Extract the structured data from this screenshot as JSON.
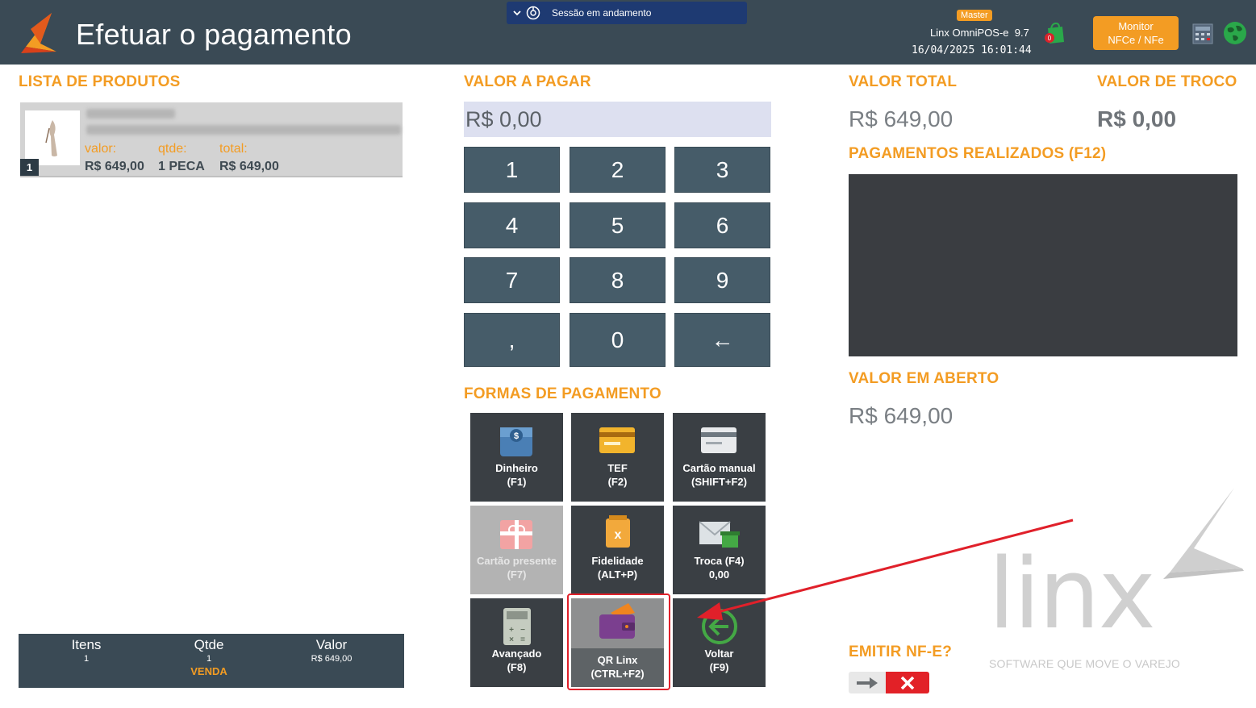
{
  "header": {
    "title": "Efetuar o pagamento",
    "session_text": "Sessão em andamento",
    "badge": "Master",
    "app_name": "Linx OmniPOS-e",
    "app_version": "9.7",
    "datetime": "16/04/2025 16:01:44",
    "bag_count": "0",
    "monitor_line1": "Monitor",
    "monitor_line2": "NFCe / NFe"
  },
  "products": {
    "title": "LISTA DE PRODUTOS",
    "items": [
      {
        "index": "1",
        "valor_label": "valor:",
        "qtde_label": "qtde:",
        "total_label": "total:",
        "valor": "R$ 649,00",
        "qtde": "1 PECA",
        "total": "R$ 649,00"
      }
    ]
  },
  "summary": {
    "itens_label": "Itens",
    "itens_value": "1",
    "qtde_label": "Qtde",
    "qtde_value": "1",
    "qtde_type": "VENDA",
    "valor_label": "Valor",
    "valor_value": "R$ 649,00"
  },
  "payment": {
    "title": "VALOR A PAGAR",
    "amount": "R$ 0,00"
  },
  "keypad": [
    "1",
    "2",
    "3",
    "4",
    "5",
    "6",
    "7",
    "8",
    "9",
    ",",
    "0",
    "←"
  ],
  "methods": {
    "title": "FORMAS DE PAGAMENTO",
    "items": [
      {
        "line1": "Dinheiro",
        "line2": "(F1)",
        "icon": "cash-icon"
      },
      {
        "line1": "TEF",
        "line2": "(F2)",
        "icon": "tef-card-icon"
      },
      {
        "line1": "Cartão manual",
        "line2": "(SHIFT+F2)",
        "icon": "manual-card-icon"
      },
      {
        "line1": "Cartão presente",
        "line2": "(F7)",
        "icon": "gift-card-icon"
      },
      {
        "line1": "Fidelidade",
        "line2": "(ALT+P)",
        "icon": "loyalty-icon"
      },
      {
        "line1": "Troca (F4)",
        "line2": "0,00",
        "icon": "exchange-icon"
      },
      {
        "line1": "Avançado",
        "line2": "(F8)",
        "icon": "calculator-icon"
      },
      {
        "line1": "QR Linx",
        "line2": "(CTRL+F2)",
        "icon": "wallet-icon"
      },
      {
        "line1": "Voltar",
        "line2": "(F9)",
        "icon": "back-arrow-icon"
      }
    ]
  },
  "totals": {
    "total_title": "VALOR TOTAL",
    "total_value": "R$ 649,00",
    "change_title": "VALOR DE TROCO",
    "change_value": "R$ 0,00",
    "payments_title": "PAGAMENTOS REALIZADOS (F12)",
    "open_title": "VALOR EM ABERTO",
    "open_value": "R$ 649,00",
    "nfe_title": "EMITIR NF-E?"
  },
  "brand": {
    "wordmark": "linx",
    "tagline": "SOFTWARE QUE MOVE O VAREJO"
  },
  "colors": {
    "header_bg": "#3a4a55",
    "accent": "#f39c23",
    "key_bg": "#465c69",
    "pay_btn_bg": "#3a3f44",
    "annotation": "#e0202a"
  }
}
